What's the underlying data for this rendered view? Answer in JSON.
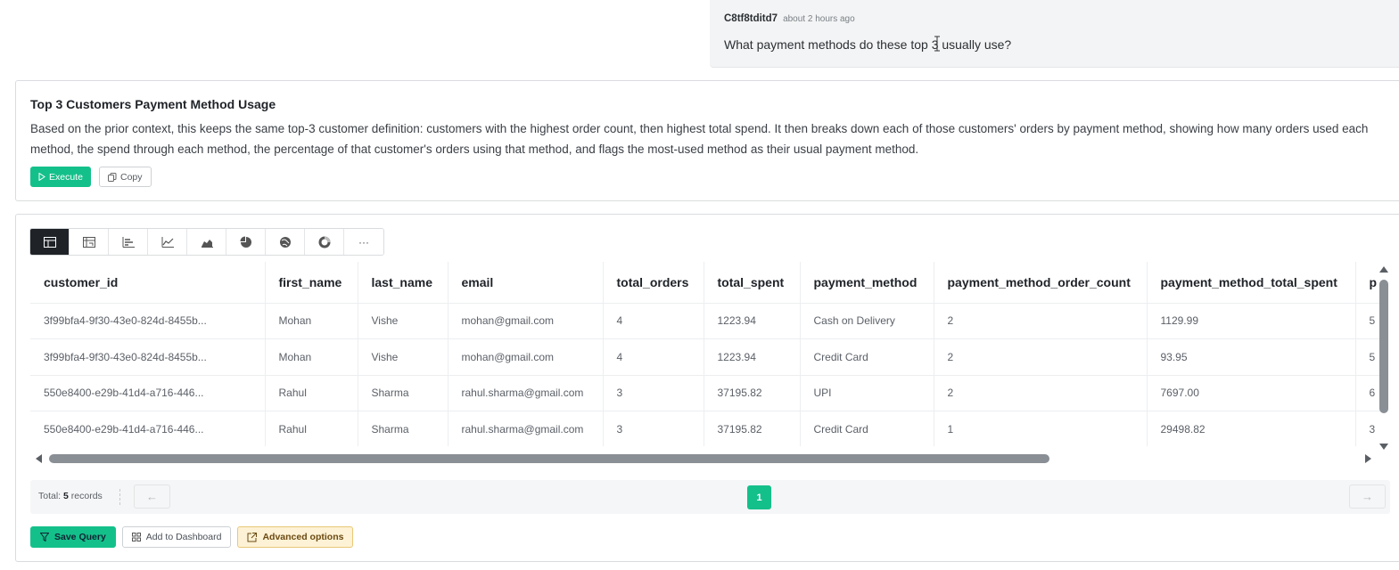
{
  "message": {
    "user": "C8tf8tditd7",
    "time": "about 2 hours ago",
    "text": "What payment methods do these top 3 usually use?"
  },
  "query_card": {
    "title": "Top 3 Customers Payment Method Usage",
    "description": "Based on the prior context, this keeps the same top-3 customer definition: customers with the highest order count, then highest total spend. It then breaks down each of those customers' orders by payment method, showing how many orders used each method, the spend through each method, the percentage of that customer's orders using that method, and flags the most-used method as their usual payment method.",
    "execute_label": "Execute",
    "copy_label": "Copy"
  },
  "viz_toolbar": {
    "buttons": [
      "table-icon",
      "pivot-icon",
      "bar-chart-icon",
      "line-chart-icon",
      "area-chart-icon",
      "pie-chart-icon",
      "map-icon",
      "donut-chart-icon",
      "more-icon"
    ],
    "more_label": "···"
  },
  "table": {
    "columns": [
      "customer_id",
      "first_name",
      "last_name",
      "email",
      "total_orders",
      "total_spent",
      "payment_method",
      "payment_method_order_count",
      "payment_method_total_spent",
      "p"
    ],
    "rows": [
      [
        "3f99bfa4-9f30-43e0-824d-8455b...",
        "Mohan",
        "Vishe",
        "mohan@gmail.com",
        "4",
        "1223.94",
        "Cash on Delivery",
        "2",
        "1129.99",
        "5"
      ],
      [
        "3f99bfa4-9f30-43e0-824d-8455b...",
        "Mohan",
        "Vishe",
        "mohan@gmail.com",
        "4",
        "1223.94",
        "Credit Card",
        "2",
        "93.95",
        "5"
      ],
      [
        "550e8400-e29b-41d4-a716-446...",
        "Rahul",
        "Sharma",
        "rahul.sharma@gmail.com",
        "3",
        "37195.82",
        "UPI",
        "2",
        "7697.00",
        "6"
      ],
      [
        "550e8400-e29b-41d4-a716-446...",
        "Rahul",
        "Sharma",
        "rahul.sharma@gmail.com",
        "3",
        "37195.82",
        "Credit Card",
        "1",
        "29498.82",
        "3"
      ]
    ]
  },
  "pager": {
    "total_prefix": "Total:",
    "total_count": "5",
    "total_suffix": "records",
    "current_page": "1",
    "prev_label": "←",
    "next_label": "→"
  },
  "actions": {
    "save_label": "Save Query",
    "dashboard_label": "Add to Dashboard",
    "advanced_label": "Advanced options"
  },
  "colors": {
    "accent": "#14c08a",
    "advanced_bg": "#fdf2d5"
  }
}
